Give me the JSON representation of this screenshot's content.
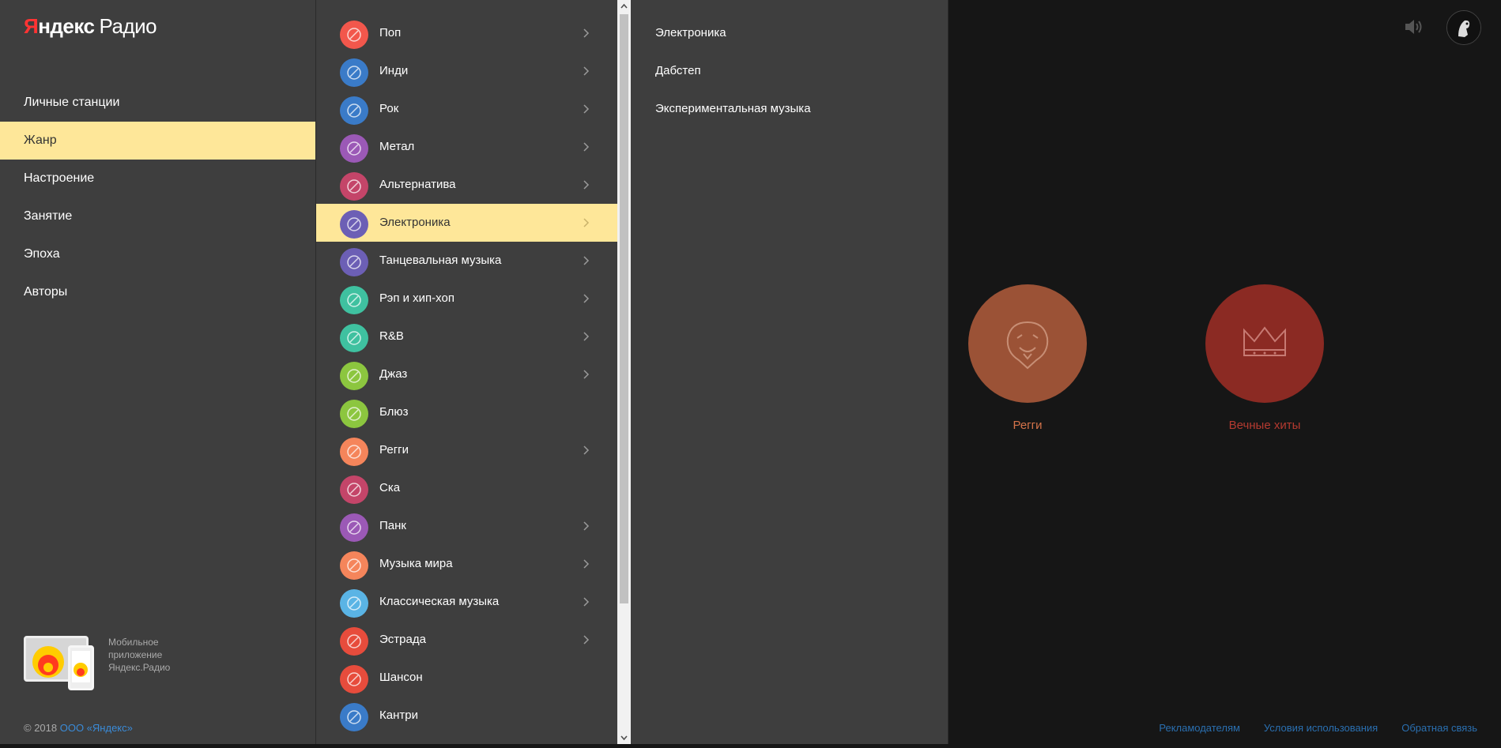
{
  "logo": {
    "brand_first": "Я",
    "brand_rest": "ндекс",
    "product": "Радио"
  },
  "nav": [
    {
      "label": "Личные станции"
    },
    {
      "label": "Жанр"
    },
    {
      "label": "Настроение"
    },
    {
      "label": "Занятие"
    },
    {
      "label": "Эпоха"
    },
    {
      "label": "Авторы"
    }
  ],
  "nav_active": "Жанр",
  "promo": {
    "line1": "Мобильное",
    "line2": "приложение",
    "line3": "Яндекс.Радио"
  },
  "copyright": {
    "text": "© 2018 ",
    "link": "ООО «Яндекс»"
  },
  "genres": [
    {
      "label": "Поп",
      "color": "#f2574c",
      "icon": "lollipop-icon",
      "chevron": true
    },
    {
      "label": "Инди",
      "color": "#3a7bc8",
      "icon": "crossed-guitars-icon",
      "chevron": true
    },
    {
      "label": "Рок",
      "color": "#3a7bc8",
      "icon": "guitar-icon",
      "chevron": true
    },
    {
      "label": "Метал",
      "color": "#9b59b6",
      "icon": "metal-hand-icon",
      "chevron": true
    },
    {
      "label": "Альтернатива",
      "color": "#c44569",
      "icon": "star-badge-icon",
      "chevron": true
    },
    {
      "label": "Электроника",
      "color": "#6c5fb5",
      "icon": "lightning-icon",
      "chevron": true
    },
    {
      "label": "Танцевальная музыка",
      "color": "#6c5fb5",
      "icon": "megaphone-icon",
      "chevron": true
    },
    {
      "label": "Рэп и хип-хоп",
      "color": "#3fc1a0",
      "icon": "chain-icon",
      "chevron": true
    },
    {
      "label": "R&B",
      "color": "#3fc1a0",
      "icon": "glasses-icon",
      "chevron": true
    },
    {
      "label": "Джаз",
      "color": "#8cc63f",
      "icon": "saxophone-icon",
      "chevron": true
    },
    {
      "label": "Блюз",
      "color": "#8cc63f",
      "icon": "harmonica-icon",
      "chevron": false
    },
    {
      "label": "Регги",
      "color": "#f5855b",
      "icon": "lion-icon",
      "chevron": true
    },
    {
      "label": "Ска",
      "color": "#c44569",
      "icon": "trumpet-icon",
      "chevron": false
    },
    {
      "label": "Панк",
      "color": "#9b59b6",
      "icon": "safety-pin-icon",
      "chevron": true
    },
    {
      "label": "Музыка мира",
      "color": "#f5855b",
      "icon": "drum-icon",
      "chevron": true
    },
    {
      "label": "Классическая музыка",
      "color": "#5ab4e5",
      "icon": "violin-icon",
      "chevron": true
    },
    {
      "label": "Эстрада",
      "color": "#e74c3c",
      "icon": "gramophone-icon",
      "chevron": true
    },
    {
      "label": "Шансон",
      "color": "#e74c3c",
      "icon": "acoustic-guitar-icon",
      "chevron": false
    },
    {
      "label": "Кантри",
      "color": "#3a7bc8",
      "icon": "harmonica-icon",
      "chevron": false
    }
  ],
  "genre_active": "Электроника",
  "subgenres": [
    {
      "label": "Электроника"
    },
    {
      "label": "Дабстеп"
    },
    {
      "label": "Экспериментальная музыка"
    }
  ],
  "stations": [
    {
      "label": "Регги",
      "color": "#9b5236",
      "text_color": "#d4734a",
      "icon": "lion-icon"
    },
    {
      "label": "Вечные хиты",
      "color": "#8b2a23",
      "text_color": "#b53a30",
      "icon": "crown-icon"
    }
  ],
  "footer": {
    "advertisers": "Рекламодателям",
    "terms": "Условия использования",
    "feedback": "Обратная связь"
  },
  "colors": {
    "accent": "#fee799",
    "panel": "#3e3e3e",
    "background": "#161616",
    "link": "#2a6fb0"
  }
}
